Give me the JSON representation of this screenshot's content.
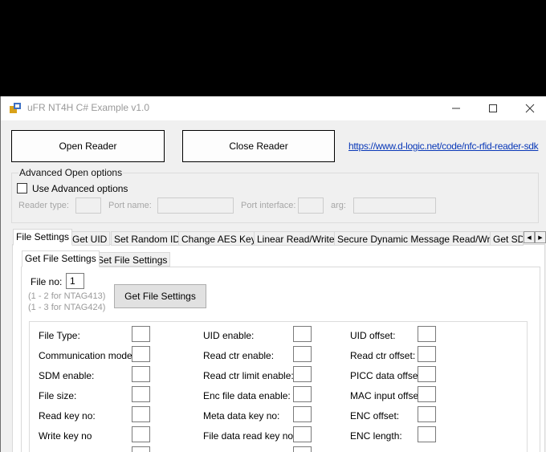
{
  "window": {
    "title": "uFR NT4H C# Example v1.0"
  },
  "top": {
    "open_reader": "Open Reader",
    "close_reader": "Close Reader",
    "link": "https://www.d-logic.net/code/nfc-rfid-reader-sdk"
  },
  "advanced": {
    "caption": "Advanced Open options",
    "use_advanced": "Use Advanced options",
    "reader_type": "Reader type:",
    "port_name": "Port name:",
    "port_interface": "Port interface:",
    "arg": "arg:"
  },
  "tabs": [
    "File Settings",
    "Get UID",
    "Set Random ID",
    "Change AES Key",
    "Linear Read/Write",
    "Secure Dynamic Message Read/Write",
    "Get SD"
  ],
  "subtabs": [
    "Get File Settings",
    "Set File Settings"
  ],
  "file_settings": {
    "file_no_label": "File no:",
    "file_no_value": "1",
    "hint1": "(1 - 2 for NTAG413)",
    "hint2": "(1 - 3 for NTAG424)",
    "get_button": "Get File Settings",
    "col1": [
      "File Type:",
      "Communication mode:",
      "SDM enable:",
      "File size:",
      "Read key no:",
      "Write key no"
    ],
    "col2": [
      "UID enable:",
      "Read ctr enable:",
      "Read ctr limit enable:",
      "Enc file data enable:",
      "Meta data key no:",
      "File data read key no:"
    ],
    "col3": [
      "UID offset:",
      "Read ctr offset:",
      "PICC data offset:",
      "MAC input offset:",
      "ENC offset:",
      "ENC  length:"
    ]
  },
  "colors": {
    "link": "#0a39b8",
    "window_bg": "#f0f0f0",
    "disabled_text": "#a6a6a6"
  }
}
